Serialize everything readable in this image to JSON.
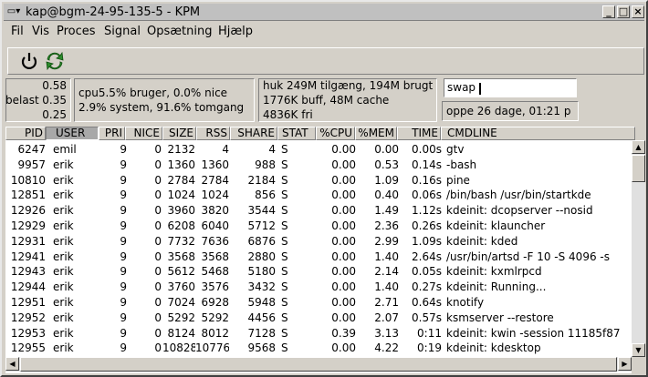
{
  "window": {
    "title": "kap@bgm-24-95-135-5 - KPM"
  },
  "menu": [
    "Fil",
    "Vis",
    "Proces",
    "Signal",
    "Opsætning",
    "Hjælp"
  ],
  "toolbar": {
    "icons": [
      "power-icon",
      "refresh-icon"
    ]
  },
  "load": {
    "label": "belast",
    "values": [
      "0.58",
      "0.35",
      "0.25"
    ]
  },
  "cpu": {
    "line1": "cpu5.5% bruger, 0.0% nice",
    "line2": "2.9% system, 91.6% tomgang"
  },
  "memory": {
    "line1": "huk 249M tilgæng, 194M brugt",
    "line2": "1776K buff, 48M cache",
    "line3": "4836K fri"
  },
  "swap": {
    "value": "swap"
  },
  "uptime": "oppe 26 dage, 01:21 p",
  "columns": [
    "PID",
    "USER",
    "PRI",
    "NICE",
    "SIZE",
    "RSS",
    "SHARE",
    "STAT",
    "%CPU",
    "%MEM",
    "TIME",
    "CMDLINE"
  ],
  "processes": [
    [
      "6247",
      "emil",
      "9",
      "0",
      "2132",
      "4",
      "4",
      "S",
      "0.00",
      "0.00",
      "0.00s",
      "gtv"
    ],
    [
      "9957",
      "erik",
      "9",
      "0",
      "1360",
      "1360",
      "988",
      "S",
      "0.00",
      "0.53",
      "0.14s",
      "-bash"
    ],
    [
      "10810",
      "erik",
      "9",
      "0",
      "2784",
      "2784",
      "2184",
      "S",
      "0.00",
      "1.09",
      "0.16s",
      "pine"
    ],
    [
      "12851",
      "erik",
      "9",
      "0",
      "1024",
      "1024",
      "856",
      "S",
      "0.00",
      "0.40",
      "0.06s",
      "/bin/bash /usr/bin/startkde"
    ],
    [
      "12926",
      "erik",
      "9",
      "0",
      "3960",
      "3820",
      "3544",
      "S",
      "0.00",
      "1.49",
      "1.12s",
      "kdeinit: dcopserver --nosid"
    ],
    [
      "12929",
      "erik",
      "9",
      "0",
      "6208",
      "6040",
      "5712",
      "S",
      "0.00",
      "2.36",
      "0.26s",
      "kdeinit: klauncher"
    ],
    [
      "12931",
      "erik",
      "9",
      "0",
      "7732",
      "7636",
      "6876",
      "S",
      "0.00",
      "2.99",
      "1.09s",
      "kdeinit: kded"
    ],
    [
      "12941",
      "erik",
      "9",
      "0",
      "3568",
      "3568",
      "2880",
      "S",
      "0.00",
      "1.40",
      "2.64s",
      "/usr/bin/artsd -F 10 -S 4096 -s"
    ],
    [
      "12943",
      "erik",
      "9",
      "0",
      "5612",
      "5468",
      "5180",
      "S",
      "0.00",
      "2.14",
      "0.05s",
      "kdeinit: kxmlrpcd"
    ],
    [
      "12944",
      "erik",
      "9",
      "0",
      "3760",
      "3576",
      "3432",
      "S",
      "0.00",
      "1.40",
      "0.27s",
      "kdeinit: Running..."
    ],
    [
      "12951",
      "erik",
      "9",
      "0",
      "7024",
      "6928",
      "5948",
      "S",
      "0.00",
      "2.71",
      "0.64s",
      "knotify"
    ],
    [
      "12952",
      "erik",
      "9",
      "0",
      "5292",
      "5292",
      "4456",
      "S",
      "0.00",
      "2.07",
      "0.57s",
      "ksmserver --restore"
    ],
    [
      "12953",
      "erik",
      "9",
      "0",
      "8124",
      "8012",
      "7128",
      "S",
      "0.39",
      "3.13",
      "0:11",
      "kdeinit: kwin -session 11185f87"
    ],
    [
      "12955",
      "erik",
      "9",
      "0",
      "10828",
      "10776",
      "9568",
      "S",
      "0.00",
      "4.22",
      "0:19",
      "kdeinit: kdesktop"
    ]
  ]
}
